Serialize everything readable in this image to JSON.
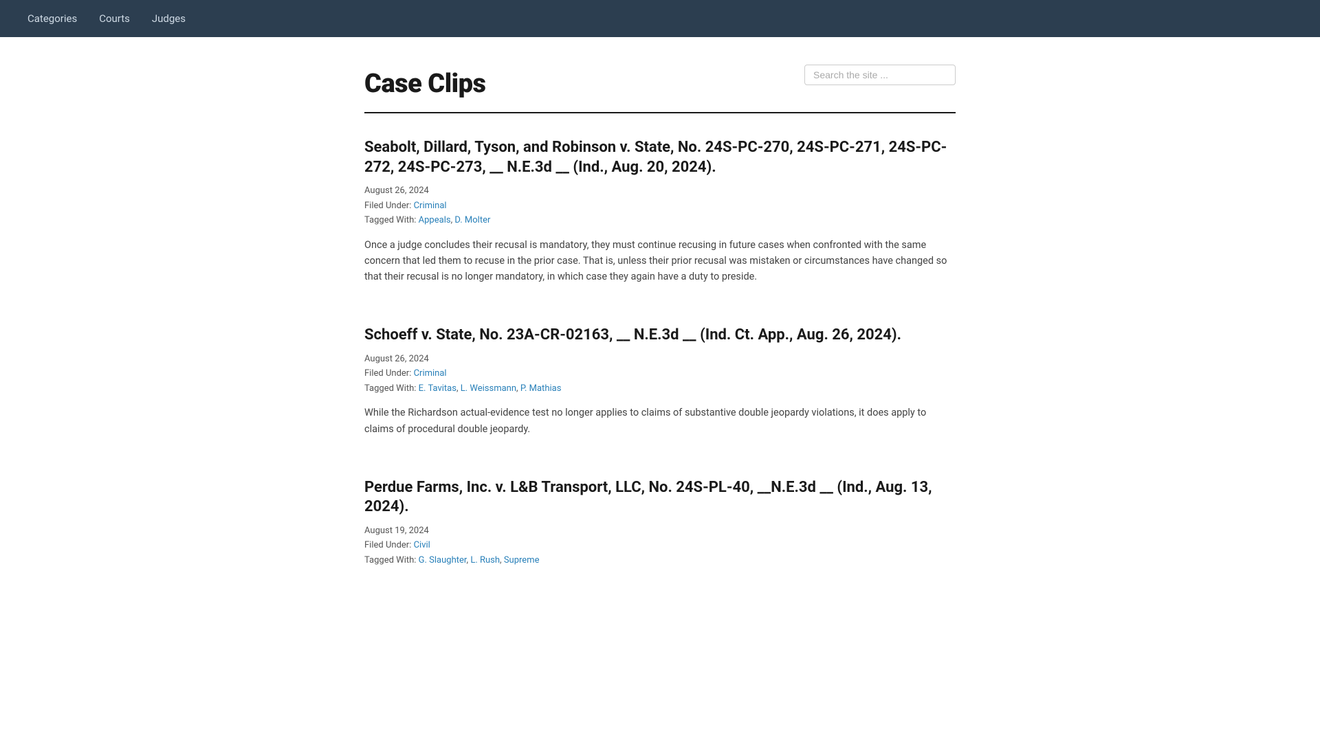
{
  "nav": {
    "items": [
      {
        "label": "Categories",
        "href": "#"
      },
      {
        "label": "Courts",
        "href": "#"
      },
      {
        "label": "Judges",
        "href": "#"
      }
    ]
  },
  "header": {
    "site_title": "Case Clips",
    "search_placeholder": "Search the site ..."
  },
  "articles": [
    {
      "id": 1,
      "title": "Seabolt, Dillard, Tyson, and Robinson v. State, No. 24S-PC-270, 24S-PC-271, 24S-PC-272, 24S-PC-273, __ N.E.3d __ (Ind., Aug. 20, 2024).",
      "date": "August 26, 2024",
      "filed_under_label": "Filed Under:",
      "filed_under": "Criminal",
      "filed_under_href": "#",
      "tagged_with_label": "Tagged With:",
      "tags": [
        {
          "label": "Appeals",
          "href": "#"
        },
        {
          "label": "D. Molter",
          "href": "#"
        }
      ],
      "tags_display": "Appeals, D. Molter",
      "summary": "Once a judge concludes their recusal is mandatory, they must continue recusing in future cases when confronted with the same concern that led them to recuse in the prior case. That is, unless their prior recusal was mistaken or circumstances have changed so that their recusal is no longer mandatory, in which case they again have a duty to preside."
    },
    {
      "id": 2,
      "title": "Schoeff v. State, No. 23A-CR-02163, __ N.E.3d __ (Ind. Ct. App., Aug. 26, 2024).",
      "date": "August 26, 2024",
      "filed_under_label": "Filed Under:",
      "filed_under": "Criminal",
      "filed_under_href": "#",
      "tagged_with_label": "Tagged With:",
      "tags": [
        {
          "label": "E. Tavitas",
          "href": "#"
        },
        {
          "label": "L. Weissmann",
          "href": "#"
        },
        {
          "label": "P. Mathias",
          "href": "#"
        }
      ],
      "tags_display": "E. Tavitas, L. Weissmann, P. Mathias",
      "summary": "While the Richardson actual-evidence test no longer applies to claims of substantive double jeopardy violations, it does apply to claims of procedural double jeopardy."
    },
    {
      "id": 3,
      "title": "Perdue Farms, Inc. v. L&B Transport, LLC, No. 24S-PL-40, __N.E.3d __ (Ind., Aug. 13, 2024).",
      "date": "August 19, 2024",
      "filed_under_label": "Filed Under:",
      "filed_under": "Civil",
      "filed_under_href": "#",
      "tagged_with_label": "Tagged With:",
      "tags": [
        {
          "label": "G. Slaughter",
          "href": "#"
        },
        {
          "label": "L. Rush",
          "href": "#"
        },
        {
          "label": "Supreme",
          "href": "#"
        }
      ],
      "tags_display": "G. Slaughter, L. Rush, Supreme",
      "summary": ""
    }
  ]
}
